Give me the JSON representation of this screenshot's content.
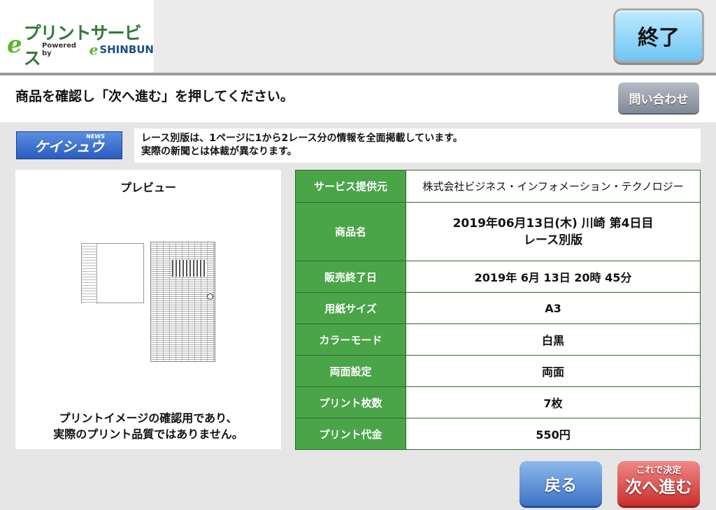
{
  "header": {
    "logo_e": "e",
    "logo_text": "プリントサービス",
    "powered_by": "Powered by",
    "logo_e2": "e",
    "logo_shinbun": "SHINBUN",
    "end_button": "終了"
  },
  "instruction": {
    "text": "商品を確認し「次へ進む」を押してください。",
    "inquiry_button": "問い合わせ"
  },
  "product": {
    "brand_news": "NEWS",
    "brand_logo_text": "ケイシュウ",
    "notice_line1": "レース別版は、1ページに1から2レース分の情報を全面掲載しています。",
    "notice_line2": "実際の新聞とは体裁が異なります。"
  },
  "preview": {
    "title": "プレビュー",
    "note_line1": "プリントイメージの確認用であり、",
    "note_line2": "実際のプリント品質ではありません。"
  },
  "details": [
    {
      "label": "サービス提供元",
      "value": "株式会社ビジネス・インフォメーション・テクノロジー"
    },
    {
      "label": "商品名",
      "value_line1": "2019年06月13日(木) 川崎 第4日目",
      "value_line2": "レース別版"
    },
    {
      "label": "販売終了日",
      "value": "2019年 6月 13日 20時 45分"
    },
    {
      "label": "用紙サイズ",
      "value": "A3"
    },
    {
      "label": "カラーモード",
      "value": "白黒"
    },
    {
      "label": "両面設定",
      "value": "両面"
    },
    {
      "label": "プリント枚数",
      "value": "7枚"
    },
    {
      "label": "プリント代金",
      "value": "550円"
    }
  ],
  "footer": {
    "back_button": "戻る",
    "next_sub": "これで決定",
    "next_main": "次へ進む"
  },
  "colors": {
    "accent_green": "#4aa448",
    "end_button": "#6ec6f5",
    "back_button": "#3c73c4",
    "next_button": "#c9302c"
  }
}
